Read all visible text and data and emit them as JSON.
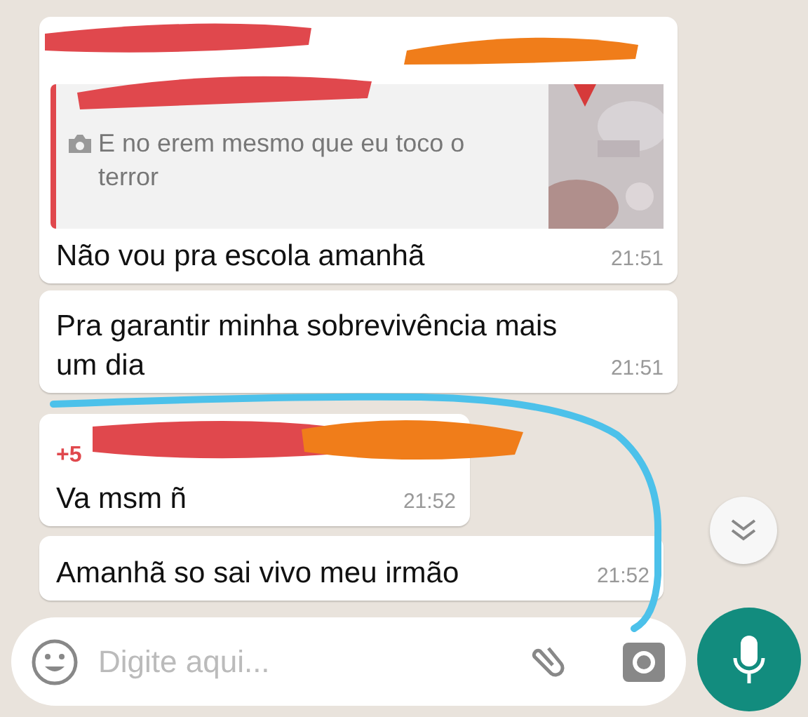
{
  "messages": [
    {
      "quote": {
        "caption": "E no erem mesmo que eu toco o terror"
      },
      "text": "Não vou pra escola amanhã",
      "time": "21:51"
    },
    {
      "text": "Pra garantir minha sobrevivência mais um dia",
      "time": "21:51"
    },
    {
      "sender": "+5",
      "text": "Va msm ñ",
      "time": "21:52"
    },
    {
      "text": "Amanhã so sai vivo meu irmão",
      "time": "21:52"
    }
  ],
  "composer": {
    "placeholder": "Digite aqui..."
  }
}
